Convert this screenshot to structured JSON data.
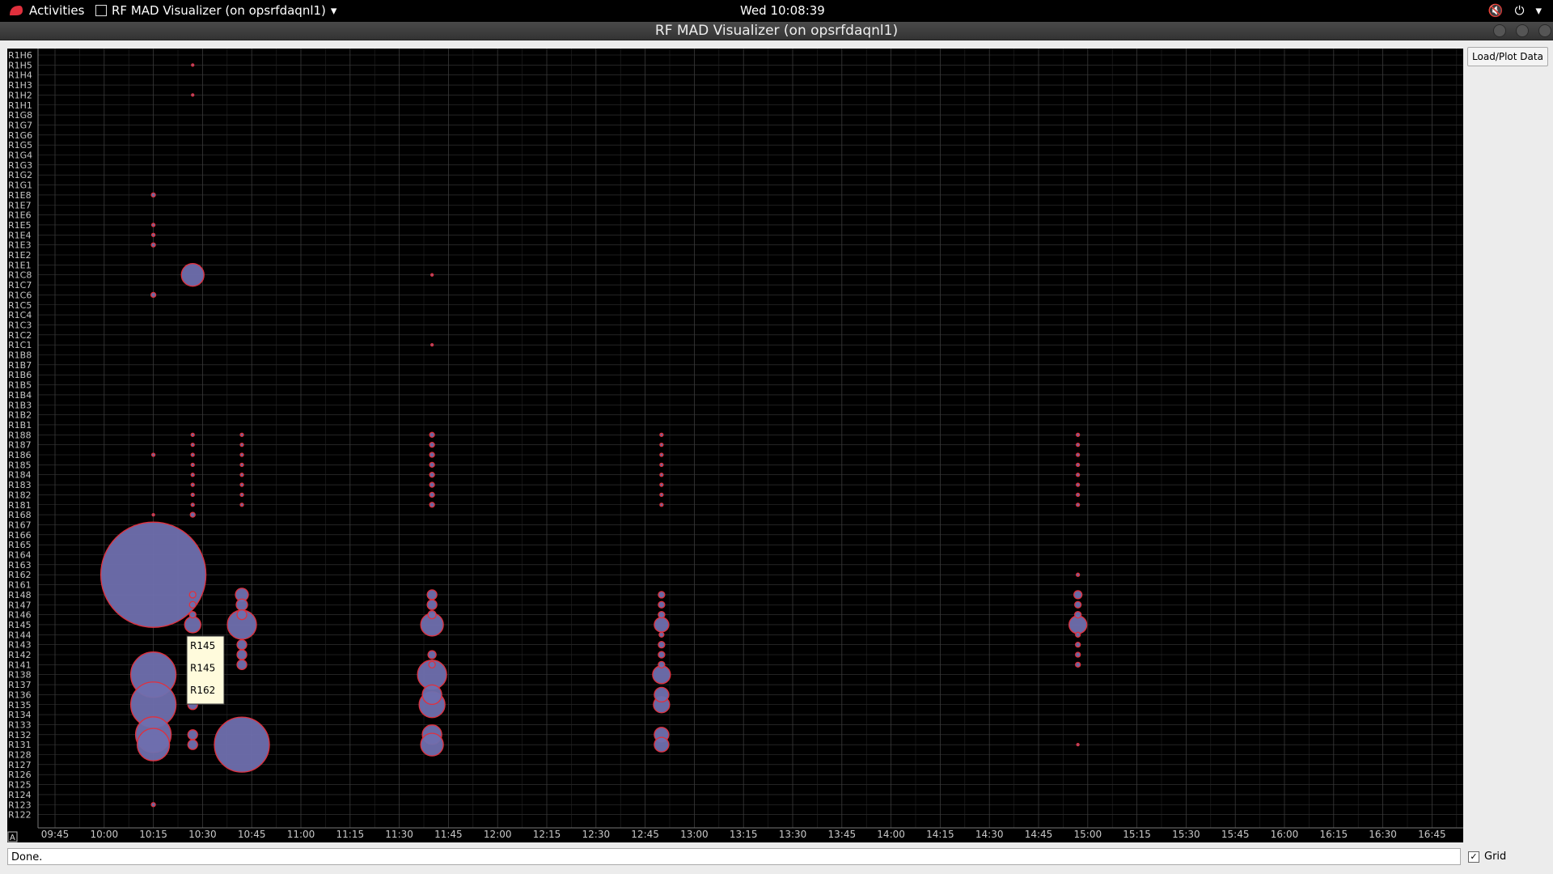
{
  "topbar": {
    "activities": "Activities",
    "app_name": "RF MAD Visualizer (on opsrfdaqnl1)",
    "clock": "Wed 10:08:39"
  },
  "window": {
    "title": "RF MAD Visualizer (on opsrfdaqnl1)"
  },
  "controls": {
    "load_button": "Load/Plot Data",
    "grid_label": "Grid",
    "grid_checked": true
  },
  "status_text": "Done.",
  "corner_label": "A",
  "tooltip": [
    "R145",
    "R145",
    "R162"
  ],
  "chart_data": {
    "type": "scatter",
    "grid": true,
    "x_ticks": [
      "09:45",
      "10:00",
      "10:15",
      "10:30",
      "10:45",
      "11:00",
      "11:15",
      "11:30",
      "11:45",
      "12:00",
      "12:15",
      "12:30",
      "12:45",
      "13:00",
      "13:15",
      "13:30",
      "13:45",
      "14:00",
      "14:15",
      "14:30",
      "14:45",
      "15:00",
      "15:15",
      "15:30",
      "15:45",
      "16:00",
      "16:15",
      "16:30",
      "16:45"
    ],
    "y_categories": [
      "R1H6",
      "R1H5",
      "R1H4",
      "R1H3",
      "R1H2",
      "R1H1",
      "R1G8",
      "R1G7",
      "R1G6",
      "R1G5",
      "R1G4",
      "R1G3",
      "R1G2",
      "R1G1",
      "R1E8",
      "R1E7",
      "R1E6",
      "R1E5",
      "R1E4",
      "R1E3",
      "R1E2",
      "R1E1",
      "R1C8",
      "R1C7",
      "R1C6",
      "R1C5",
      "R1C4",
      "R1C3",
      "R1C2",
      "R1C1",
      "R1B8",
      "R1B7",
      "R1B6",
      "R1B5",
      "R1B4",
      "R1B3",
      "R1B2",
      "R1B1",
      "R188",
      "R187",
      "R186",
      "R185",
      "R184",
      "R183",
      "R182",
      "R181",
      "R168",
      "R167",
      "R166",
      "R165",
      "R164",
      "R163",
      "R162",
      "R161",
      "R148",
      "R147",
      "R146",
      "R145",
      "R144",
      "R143",
      "R142",
      "R141",
      "R138",
      "R137",
      "R136",
      "R135",
      "R134",
      "R133",
      "R132",
      "R131",
      "R128",
      "R127",
      "R126",
      "R125",
      "R124",
      "R123",
      "R122"
    ],
    "points": [
      [
        "10:15",
        "R162",
        65
      ],
      [
        "10:15",
        "R138",
        28
      ],
      [
        "10:15",
        "R135",
        28
      ],
      [
        "10:15",
        "R132",
        22
      ],
      [
        "10:15",
        "R131",
        20
      ],
      [
        "10:15",
        "R1E8",
        2.5
      ],
      [
        "10:15",
        "R1E5",
        2
      ],
      [
        "10:15",
        "R1E4",
        2
      ],
      [
        "10:15",
        "R1E3",
        2.5
      ],
      [
        "10:15",
        "R1C6",
        3
      ],
      [
        "10:15",
        "R186",
        2
      ],
      [
        "10:15",
        "R168",
        1.5
      ],
      [
        "10:15",
        "R123",
        2.5
      ],
      [
        "10:27",
        "R1C8",
        14
      ],
      [
        "10:27",
        "R145",
        10
      ],
      [
        "10:27",
        "R148",
        4
      ],
      [
        "10:27",
        "R147",
        4
      ],
      [
        "10:27",
        "R146",
        4
      ],
      [
        "10:27",
        "R135",
        6
      ],
      [
        "10:27",
        "R132",
        6
      ],
      [
        "10:27",
        "R131",
        6
      ],
      [
        "10:27",
        "R168",
        3
      ],
      [
        "10:27",
        "R188",
        2
      ],
      [
        "10:27",
        "R187",
        2
      ],
      [
        "10:27",
        "R186",
        2
      ],
      [
        "10:27",
        "R185",
        2
      ],
      [
        "10:27",
        "R184",
        2
      ],
      [
        "10:27",
        "R183",
        2
      ],
      [
        "10:27",
        "R182",
        2
      ],
      [
        "10:27",
        "R181",
        2
      ],
      [
        "10:27",
        "R1H5",
        1.5
      ],
      [
        "10:27",
        "R1H2",
        1.5
      ],
      [
        "10:42",
        "R131",
        34
      ],
      [
        "10:42",
        "R145",
        18
      ],
      [
        "10:42",
        "R148",
        8
      ],
      [
        "10:42",
        "R147",
        7
      ],
      [
        "10:42",
        "R146",
        6
      ],
      [
        "10:42",
        "R143",
        6
      ],
      [
        "10:42",
        "R142",
        6
      ],
      [
        "10:42",
        "R141",
        6
      ],
      [
        "10:42",
        "R188",
        2
      ],
      [
        "10:42",
        "R187",
        2
      ],
      [
        "10:42",
        "R186",
        2
      ],
      [
        "10:42",
        "R185",
        2
      ],
      [
        "10:42",
        "R184",
        2
      ],
      [
        "10:42",
        "R183",
        2
      ],
      [
        "10:42",
        "R182",
        2
      ],
      [
        "10:42",
        "R181",
        2
      ],
      [
        "11:40",
        "R138",
        18
      ],
      [
        "11:40",
        "R135",
        16
      ],
      [
        "11:40",
        "R136",
        12
      ],
      [
        "11:40",
        "R132",
        12
      ],
      [
        "11:40",
        "R131",
        14
      ],
      [
        "11:40",
        "R145",
        14
      ],
      [
        "11:40",
        "R148",
        6
      ],
      [
        "11:40",
        "R147",
        6
      ],
      [
        "11:40",
        "R146",
        5
      ],
      [
        "11:40",
        "R142",
        5
      ],
      [
        "11:40",
        "R141",
        4
      ],
      [
        "11:40",
        "R188",
        3
      ],
      [
        "11:40",
        "R187",
        3
      ],
      [
        "11:40",
        "R186",
        3
      ],
      [
        "11:40",
        "R185",
        3
      ],
      [
        "11:40",
        "R184",
        3
      ],
      [
        "11:40",
        "R183",
        3
      ],
      [
        "11:40",
        "R182",
        3
      ],
      [
        "11:40",
        "R181",
        3
      ],
      [
        "11:40",
        "R1C1",
        1.5
      ],
      [
        "11:40",
        "R1C8",
        1.5
      ],
      [
        "12:50",
        "R138",
        11
      ],
      [
        "12:50",
        "R135",
        10
      ],
      [
        "12:50",
        "R136",
        9
      ],
      [
        "12:50",
        "R132",
        9
      ],
      [
        "12:50",
        "R131",
        9
      ],
      [
        "12:50",
        "R145",
        9
      ],
      [
        "12:50",
        "R148",
        4
      ],
      [
        "12:50",
        "R147",
        4
      ],
      [
        "12:50",
        "R146",
        4
      ],
      [
        "12:50",
        "R144",
        3
      ],
      [
        "12:50",
        "R143",
        4
      ],
      [
        "12:50",
        "R142",
        4
      ],
      [
        "12:50",
        "R141",
        4
      ],
      [
        "12:50",
        "R188",
        2
      ],
      [
        "12:50",
        "R187",
        2
      ],
      [
        "12:50",
        "R186",
        2
      ],
      [
        "12:50",
        "R185",
        2
      ],
      [
        "12:50",
        "R184",
        2
      ],
      [
        "12:50",
        "R183",
        2
      ],
      [
        "12:50",
        "R182",
        2
      ],
      [
        "12:50",
        "R181",
        2
      ],
      [
        "14:57",
        "R145",
        11
      ],
      [
        "14:57",
        "R148",
        5
      ],
      [
        "14:57",
        "R147",
        4
      ],
      [
        "14:57",
        "R146",
        4
      ],
      [
        "14:57",
        "R144",
        3
      ],
      [
        "14:57",
        "R143",
        3
      ],
      [
        "14:57",
        "R142",
        3
      ],
      [
        "14:57",
        "R141",
        3
      ],
      [
        "14:57",
        "R162",
        2
      ],
      [
        "14:57",
        "R131",
        1.5
      ],
      [
        "14:57",
        "R188",
        2
      ],
      [
        "14:57",
        "R187",
        2
      ],
      [
        "14:57",
        "R186",
        2
      ],
      [
        "14:57",
        "R185",
        2
      ],
      [
        "14:57",
        "R184",
        2
      ],
      [
        "14:57",
        "R183",
        2
      ],
      [
        "14:57",
        "R182",
        2
      ],
      [
        "14:57",
        "R181",
        2
      ]
    ],
    "colors": {
      "bubble_fill": "#6f6fae",
      "bubble_stroke": "#e0303d",
      "background": "#000000",
      "grid": "#3a3a3a",
      "tick_text": "#c8c8c8"
    }
  }
}
